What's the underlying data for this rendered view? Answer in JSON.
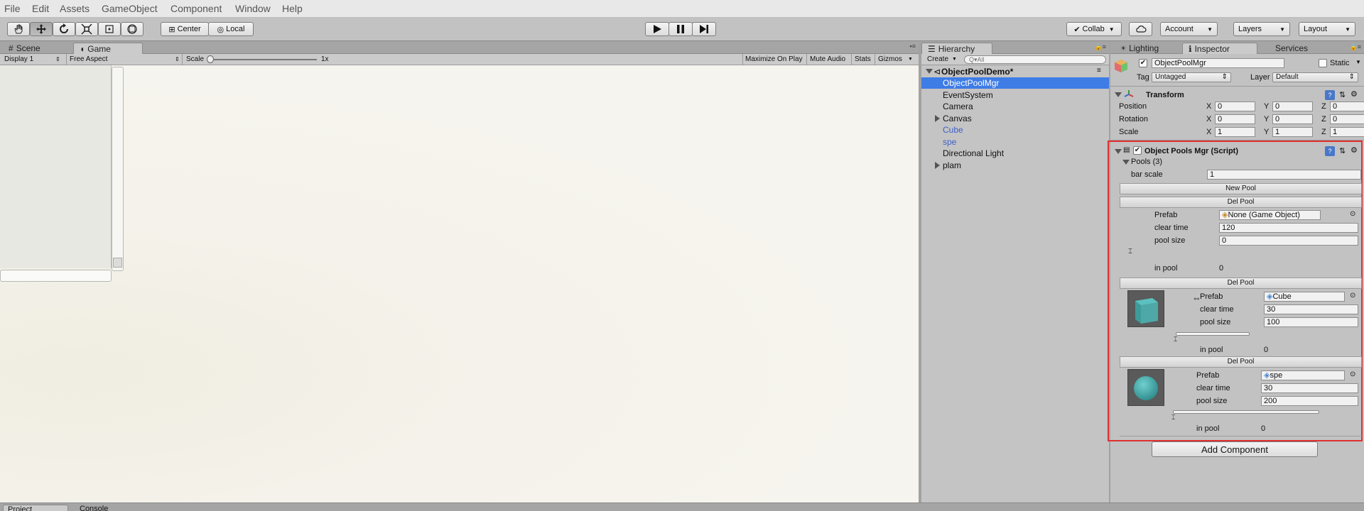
{
  "menu": [
    "File",
    "Edit",
    "Assets",
    "GameObject",
    "Component",
    "Window",
    "Help"
  ],
  "toolbar": {
    "pivot": "Center",
    "space": "Local",
    "collab": "Collab",
    "account": "Account",
    "layers": "Layers",
    "layout": "Layout"
  },
  "game_panel": {
    "tabs": [
      "Scene",
      "Game"
    ],
    "display": "Display 1",
    "aspect": "Free Aspect",
    "scale_label": "Scale",
    "scale_value": "1x",
    "maximize": "Maximize On Play",
    "mute": "Mute Audio",
    "stats": "Stats",
    "gizmos": "Gizmos"
  },
  "hierarchy": {
    "tab": "Hierarchy",
    "create": "Create",
    "search_placeholder": "Q▾All",
    "scene": "ObjectPoolDemo*",
    "items": [
      "ObjectPoolMgr",
      "EventSystem",
      "Camera",
      "Canvas",
      "Cube",
      "spe",
      "Directional Light",
      "plam"
    ]
  },
  "inspector": {
    "tabs": [
      "Lighting",
      "Inspector",
      "Services"
    ],
    "object_name": "ObjectPoolMgr",
    "static_label": "Static",
    "tag_label": "Tag",
    "tag_value": "Untagged",
    "layer_label": "Layer",
    "layer_value": "Default",
    "transform": {
      "title": "Transform",
      "axes": [
        "X",
        "Y",
        "Z"
      ],
      "rows": [
        {
          "label": "Position",
          "x": "0",
          "y": "0",
          "z": "0"
        },
        {
          "label": "Rotation",
          "x": "0",
          "y": "0",
          "z": "0"
        },
        {
          "label": "Scale",
          "x": "1",
          "y": "1",
          "z": "1"
        }
      ]
    },
    "script": {
      "title": "Object Pools Mgr (Script)",
      "pools_label": "Pools (3)",
      "bar_scale_label": "bar scale",
      "bar_scale_value": "1",
      "new_pool": "New Pool",
      "del_pool": "Del Pool",
      "prefab_label": "Prefab",
      "clear_time_label": "clear time",
      "pool_size_label": "pool size",
      "in_pool_label": "in pool",
      "pools": [
        {
          "prefab": "None (Game Object)",
          "clear_time": "120",
          "pool_size": "0",
          "in_pool": "0"
        },
        {
          "prefab": "Cube",
          "clear_time": "30",
          "pool_size": "100",
          "in_pool": "0"
        },
        {
          "prefab": "spe",
          "clear_time": "30",
          "pool_size": "200",
          "in_pool": "0"
        }
      ]
    },
    "add_component": "Add Component"
  },
  "bottom_tabs": [
    "Project",
    "Console"
  ],
  "colors": {
    "selection": "#3e7ce6",
    "prefab_text": "#4060c4",
    "highlight_border": "#e03030",
    "cube_color": "#4fa8a8"
  }
}
